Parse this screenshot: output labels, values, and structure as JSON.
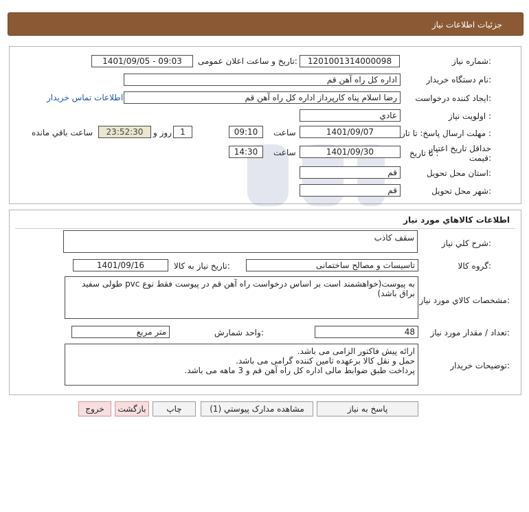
{
  "title": "جزئيات اطلاعات نياز",
  "info": {
    "need_number_label": "شماره نياز:",
    "need_number": "1201001314000098",
    "announce_label": "تاريخ و ساعت اعلان عمومی:",
    "announce_value": "1401/09/05 - 09:03",
    "buyer_label": "نام دستگاه خريدار:",
    "buyer_value": "اداره کل  راه آهن قم",
    "creator_label": "ايجاد کننده درخواست:",
    "creator_value": "رضا اسلام پناه کارپرداز اداره کل  راه آهن قم",
    "contact_link": "اطلاعات تماس خريدار",
    "priority_label": "اولويت نياز :",
    "priority_value": "عادي",
    "deadline_label": "مهلت ارسال پاسخ:  تا تاريخ :",
    "deadline_date": "1401/09/07",
    "time_label": "ساعت",
    "deadline_time": "09:10",
    "days_value": "1",
    "days_label": "روز و",
    "remaining_value": "23:52:30",
    "remaining_label": "ساعت باقي مانده",
    "validity_label_1": "حداقل تاريخ اعتبار",
    "validity_label_2": "قيمت:",
    "validity_to_label": "تا تاريخ :",
    "validity_date": "1401/09/30",
    "validity_time": "14:30",
    "province_label": "استان محل تحويل:",
    "province_value": "قم",
    "city_label": "شهر محل تحويل:",
    "city_value": "قم"
  },
  "goods": {
    "section_title": "اطلاعات کالاهاي مورد نياز",
    "desc_label": "شرح کلي نياز:",
    "desc_value": "سقف کاذب",
    "group_label": "گروه کالا:",
    "group_value": "تاسيسات و مصالح ساختمانی",
    "need_date_label": "تاريخ نياز به کالا:",
    "need_date_value": "1401/09/16",
    "specs_label": "مشخصات کالاي مورد نياز:",
    "specs_value": "به پیوست(خواهشمند است بر اساس درخواست راه آهن قم در پیوست فقط نوع pvc طولی سفید براق باشد)",
    "qty_label": "تعداد / مقدار مورد نياز:",
    "qty_value": "48",
    "unit_label": "واحد شمارش:",
    "unit_value": "متر مربع",
    "buyer_notes_label": "توضيحات خريدار:",
    "buyer_notes_lines": [
      "ارائه پیش فاکتور الزامی می باشد.",
      "حمل و نقل کالا برعهده تامین کننده گرامی می باشد.",
      "پرداخت طبق ضوابط مالی اداره کل راه آهن قم و 3 ماهه می باشد."
    ]
  },
  "buttons": {
    "reply": "پاسخ به نياز",
    "attachments": "مشاهده مدارک پيوستي (1)",
    "print": "چاپ",
    "back": "بازگشت",
    "exit": "خروج"
  },
  "colors": {
    "header_bg": "#8b5a34",
    "highlight_box": "#eae6cf",
    "link": "#1a55b0",
    "exit_button": "#f8dede"
  }
}
